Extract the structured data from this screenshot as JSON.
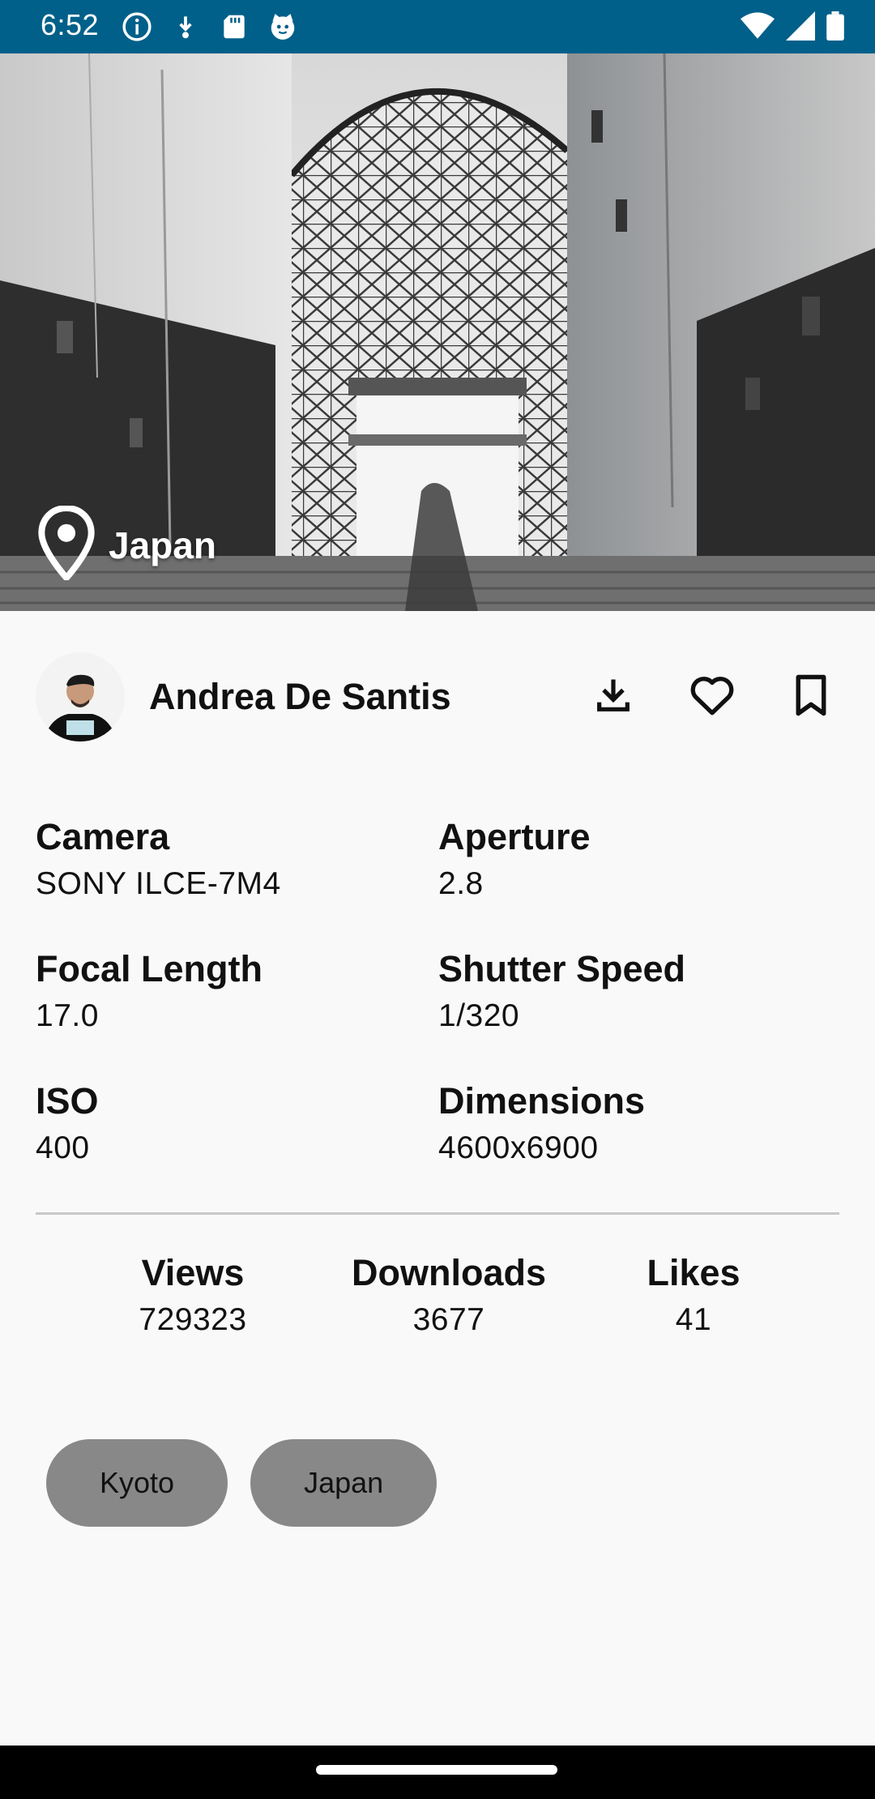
{
  "status_bar": {
    "time": "6:52",
    "left_icons": [
      "info-icon",
      "download-notification-icon",
      "sd-card-icon",
      "cat-face-icon"
    ],
    "right_icons": [
      "wifi-icon",
      "cell-signal-icon",
      "battery-icon"
    ],
    "background": "#00608a"
  },
  "photo": {
    "location_label": "Japan",
    "location_icon": "location-pin-icon"
  },
  "author": {
    "name": "Andrea De Santis",
    "actions": [
      {
        "icon": "download-icon"
      },
      {
        "icon": "heart-icon"
      },
      {
        "icon": "bookmark-icon"
      }
    ]
  },
  "exif": {
    "camera": {
      "label": "Camera",
      "value": "SONY ILCE-7M4"
    },
    "aperture": {
      "label": "Aperture",
      "value": "2.8"
    },
    "focal_length": {
      "label": "Focal Length",
      "value": "17.0"
    },
    "shutter_speed": {
      "label": "Shutter Speed",
      "value": "1/320"
    },
    "iso": {
      "label": "ISO",
      "value": "400"
    },
    "dimensions": {
      "label": "Dimensions",
      "value": "4600x6900"
    }
  },
  "stats": {
    "views": {
      "label": "Views",
      "value": "729323"
    },
    "downloads": {
      "label": "Downloads",
      "value": "3677"
    },
    "likes": {
      "label": "Likes",
      "value": "41"
    }
  },
  "tags": [
    "Kyoto",
    "Japan"
  ],
  "colors": {
    "tag_background": "#888888",
    "page_background": "#f9f9f9",
    "divider": "#c8c8c8"
  }
}
